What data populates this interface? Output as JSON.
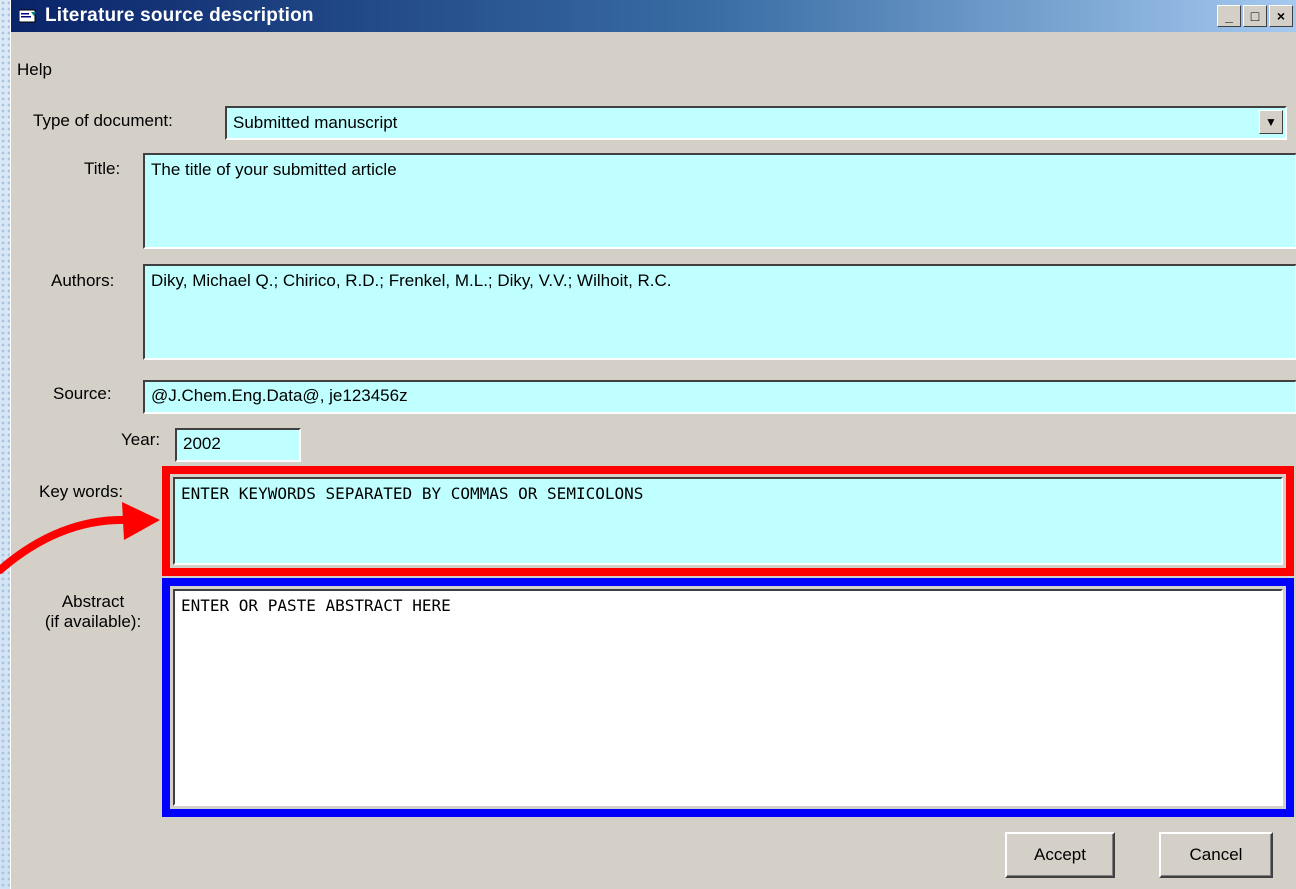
{
  "window": {
    "title": "Literature source description",
    "controls": {
      "minimize": "_",
      "maximize": "□",
      "close": "×"
    }
  },
  "menu": {
    "help": "Help"
  },
  "form": {
    "doc_type_label": "Type of document:",
    "doc_type_value": "Submitted manuscript",
    "title_label": "Title:",
    "title_value": "The title of your submitted article",
    "authors_label": "Authors:",
    "authors_value": "Diky, Michael Q.; Chirico, R.D.; Frenkel, M.L.; Diky, V.V.; Wilhoit, R.C.",
    "source_label": "Source:",
    "source_value": "@J.Chem.Eng.Data@, je123456z",
    "year_label": "Year:",
    "year_value": "2002",
    "keywords_label": "Key words:",
    "keywords_value": "ENTER KEYWORDS SEPARATED BY COMMAS OR SEMICOLONS",
    "abstract_label_line1": "Abstract",
    "abstract_label_line2": "(if available):",
    "abstract_value": "ENTER OR PASTE ABSTRACT HERE"
  },
  "buttons": {
    "accept": "Accept",
    "cancel": "Cancel"
  },
  "colors": {
    "field_bg": "#c0ffff",
    "highlight_keywords": "#ff0000",
    "highlight_abstract": "#0000ff",
    "titlebar_start": "#0a246a"
  },
  "icons": {
    "app": "window-app-icon",
    "dropdown": "chevron-down-icon",
    "arrow": "red-arrow-annotation"
  }
}
